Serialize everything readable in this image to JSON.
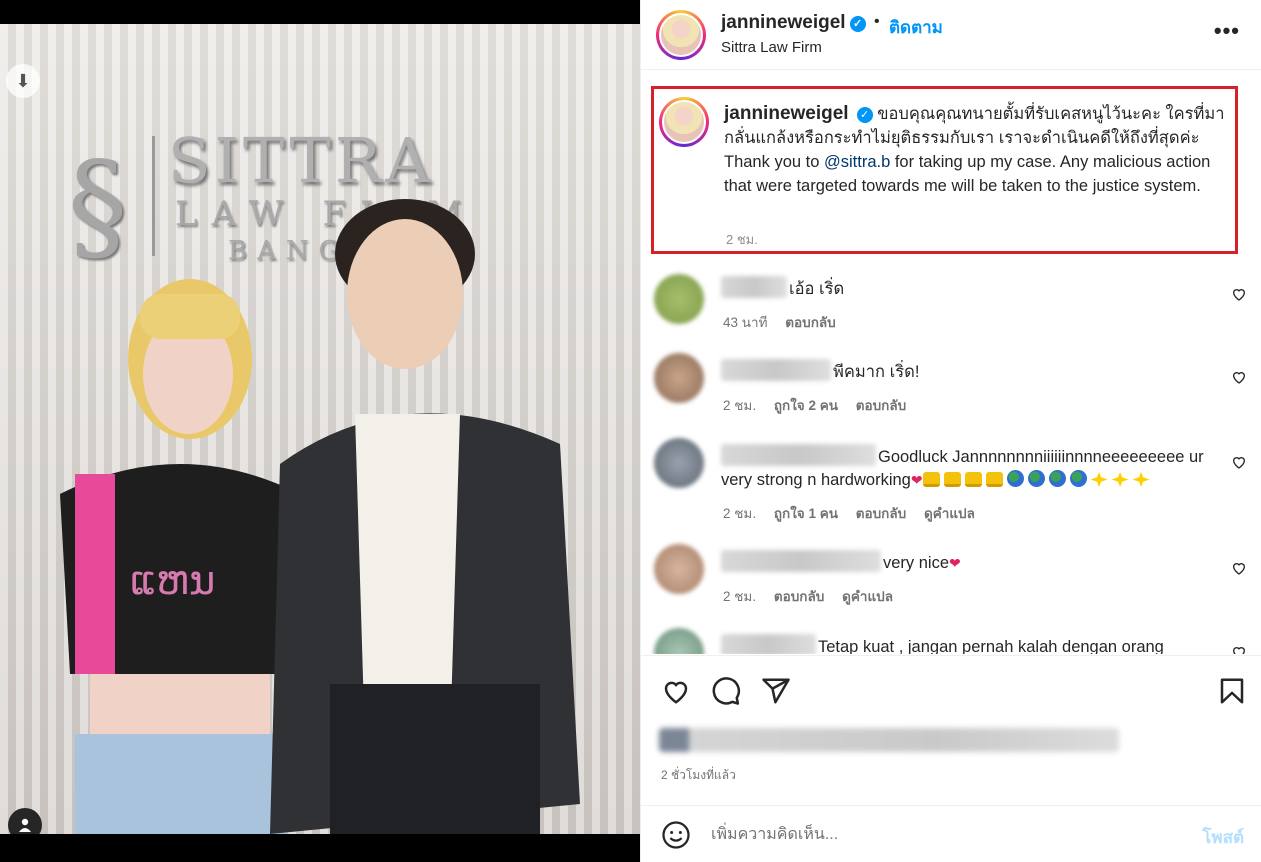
{
  "photo": {
    "logo_word": "SITTRA",
    "logo_sub": "LAW FIRM",
    "logo_sub2": "BANG"
  },
  "header": {
    "username": "jannineweigel",
    "follow_label": "ติดตาม",
    "location": "Sittra Law Firm",
    "more_label": "•••"
  },
  "caption": {
    "username": "jannineweigel",
    "text_thai": "ขอบคุณคุณทนายตั้มที่รับเคสหนูไว้นะคะ ใครที่มากลั่นแกล้งหรือกระทำไม่ยุติธรรมกับเรา เราจะดำเนินคดีให้ถึงที่สุดค่ะ",
    "text_en_before": "Thank you to ",
    "mention": "@sittra.b",
    "text_en_after": " for taking up my case. Any malicious action that were targeted towards me will be taken to the justice system.",
    "time": "2 ชม."
  },
  "comments": [
    {
      "text": "เอ้อ เริ่ด",
      "time": "43 นาที",
      "likes": "",
      "reply": "ตอบกลับ",
      "translate": ""
    },
    {
      "text": "พีคมาก เริ่ด!",
      "time": "2 ชม.",
      "likes": "ถูกใจ 2 คน",
      "reply": "ตอบกลับ",
      "translate": ""
    },
    {
      "text": "Goodluck Jannnnnnnniiiiiinnnneeeeeeeee ur very strong n hardworking",
      "time": "2 ชม.",
      "likes": "ถูกใจ 1 คน",
      "reply": "ตอบกลับ",
      "translate": "ดูคำแปล"
    },
    {
      "text": "very nice",
      "time": "2 ชม.",
      "likes": "",
      "reply": "ตอบกลับ",
      "translate": "ดูคำแปล"
    },
    {
      "text": "Tetap kuat , jangan pernah kalah dengan orang"
    }
  ],
  "footer": {
    "post_time": "2 ชั่วโมงที่แล้ว",
    "comment_placeholder": "เพิ่มความคิดเห็น...",
    "post_label": "โพสต์"
  },
  "colors": {
    "accent": "#0095f6",
    "highlight_border": "#d92027",
    "post_disabled": "#b2dffc"
  }
}
